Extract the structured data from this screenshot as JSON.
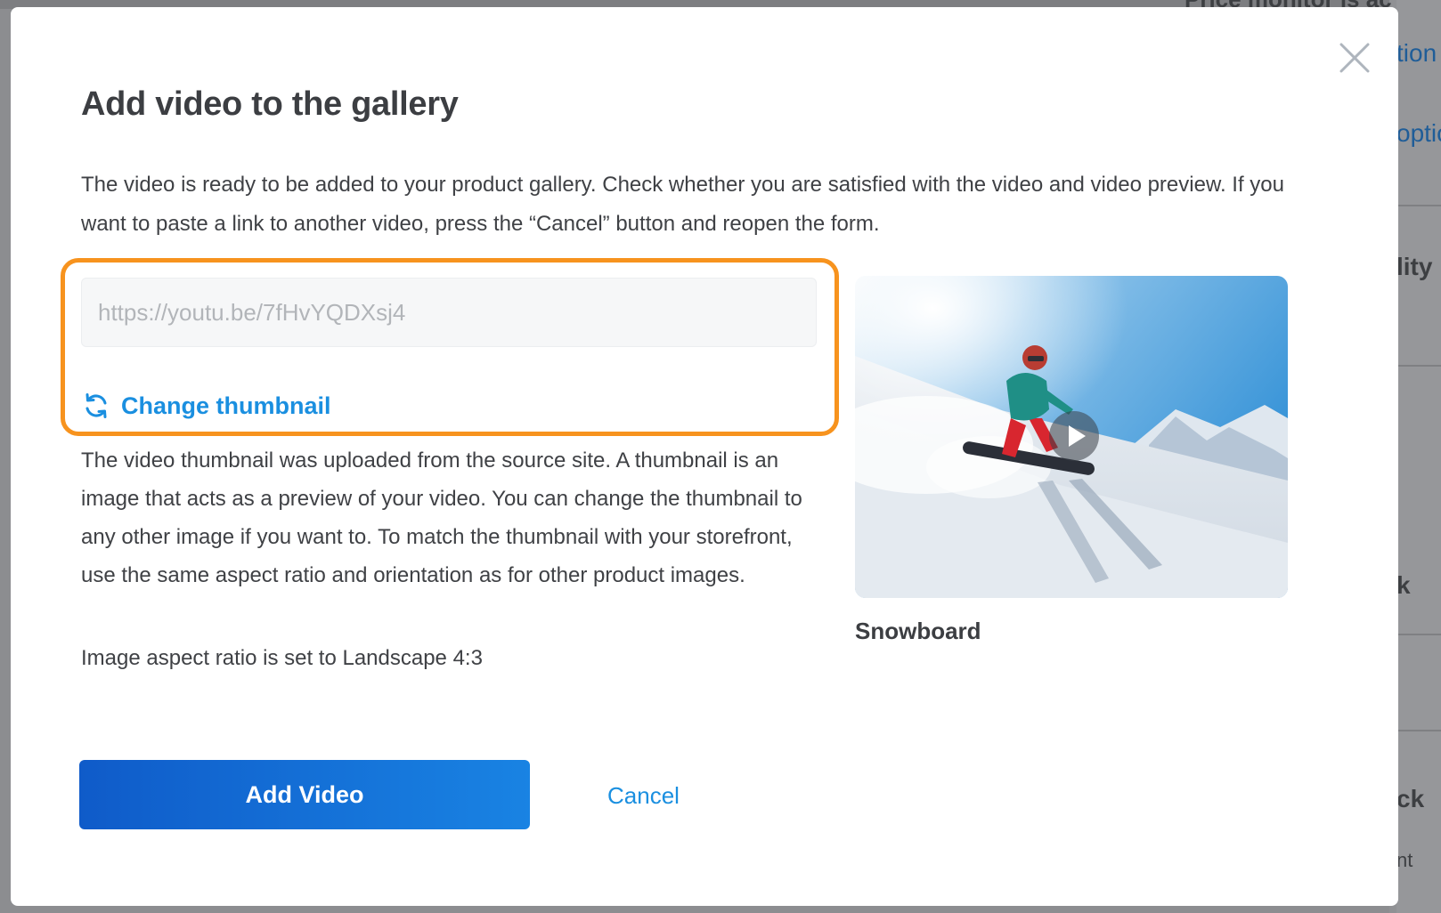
{
  "background": {
    "fragments": [
      "Price monitor is ac",
      "tion",
      "optio",
      "lity",
      "k",
      "ck",
      "nt"
    ]
  },
  "modal": {
    "title": "Add video to the gallery",
    "intro": "The video is ready to be added to your product gallery. Check whether you are satisfied with the video and video preview. If you want to paste a link to another video, press the “Cancel” button and reopen the form.",
    "url_input": {
      "placeholder": "https://youtu.be/7fHvYQDXsj4",
      "value": ""
    },
    "change_thumbnail_label": "Change thumbnail",
    "thumbnail_description": "The video thumbnail was uploaded from the source site. A thumbnail is an image that acts as a preview of your video. You can change the thumbnail to any other image if you want to. To match the thumbnail with your storefront, use the same aspect ratio and orientation as for other product images.",
    "aspect_ratio_note": "Image aspect ratio is set to Landscape 4:3",
    "preview_caption": "Snowboard",
    "add_button_label": "Add Video",
    "cancel_button_label": "Cancel"
  },
  "colors": {
    "accent": "#1a8fe0",
    "primary_button": "#1366d6",
    "highlight": "#f7931e",
    "overlay": "#8e8f92"
  },
  "icons": {
    "close": "close-icon",
    "refresh": "refresh-icon",
    "play": "play-icon"
  }
}
